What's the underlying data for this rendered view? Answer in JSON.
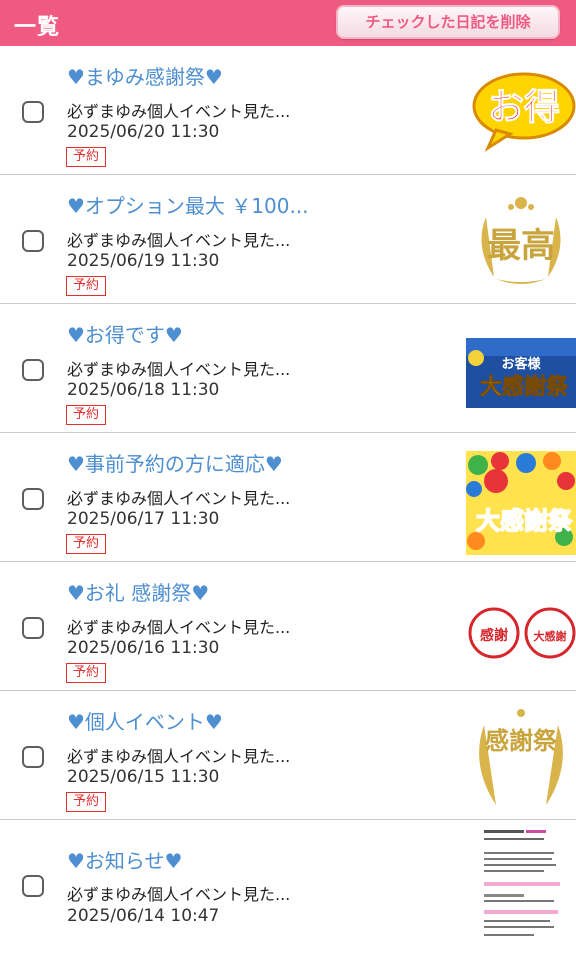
{
  "header": {
    "title": "一覧",
    "delete_label": "チェックした日記を削除"
  },
  "colors": {
    "accent": "#ef5a82",
    "title_blue": "#4d8fd0",
    "badge_red": "#e03030"
  },
  "entries": [
    {
      "title": "♥まゆみ感謝祭♥",
      "preview": "必ずまゆみ個人イベント見た...",
      "date": "2025/06/20 11:30",
      "badge": "予約",
      "thumb_text": "お得",
      "thumb_icon": "otoku-badge-image"
    },
    {
      "title": "♥オプション最大 ￥100...",
      "preview": "必ずまゆみ個人イベント見た...",
      "date": "2025/06/19 11:30",
      "badge": "予約",
      "thumb_text": "最高",
      "thumb_icon": "saikou-laurel-image"
    },
    {
      "title": "♥お得です♥",
      "preview": "必ずまゆみ個人イベント見た...",
      "date": "2025/06/18 11:30",
      "badge": "予約",
      "thumb_text_small": "お客様",
      "thumb_text": "大感謝祭",
      "thumb_icon": "okyakusama-daikanshasai-banner"
    },
    {
      "title": "♥事前予約の方に適応♥",
      "preview": "必ずまゆみ個人イベント見た...",
      "date": "2025/06/17 11:30",
      "badge": "予約",
      "thumb_text": "大感謝祭",
      "thumb_icon": "balloons-daikanshasai-image"
    },
    {
      "title": "♥お礼 感謝祭♥",
      "preview": "必ずまゆみ個人イベント見た...",
      "date": "2025/06/16 11:30",
      "badge": "予約",
      "thumb_text": "感謝",
      "thumb_text2": "大感謝",
      "thumb_icon": "kansha-stamps-image"
    },
    {
      "title": "♥個人イベント♥",
      "preview": "必ずまゆみ個人イベント見た...",
      "date": "2025/06/15 11:30",
      "badge": "予約",
      "thumb_text": "感謝祭",
      "thumb_icon": "kanshasai-laurel-image"
    },
    {
      "title": "♥お知らせ♥",
      "preview": "必ずまゆみ個人イベント見た...",
      "date": "2025/06/14 10:47",
      "badge": "",
      "thumb_icon": "text-flyer-image"
    }
  ]
}
